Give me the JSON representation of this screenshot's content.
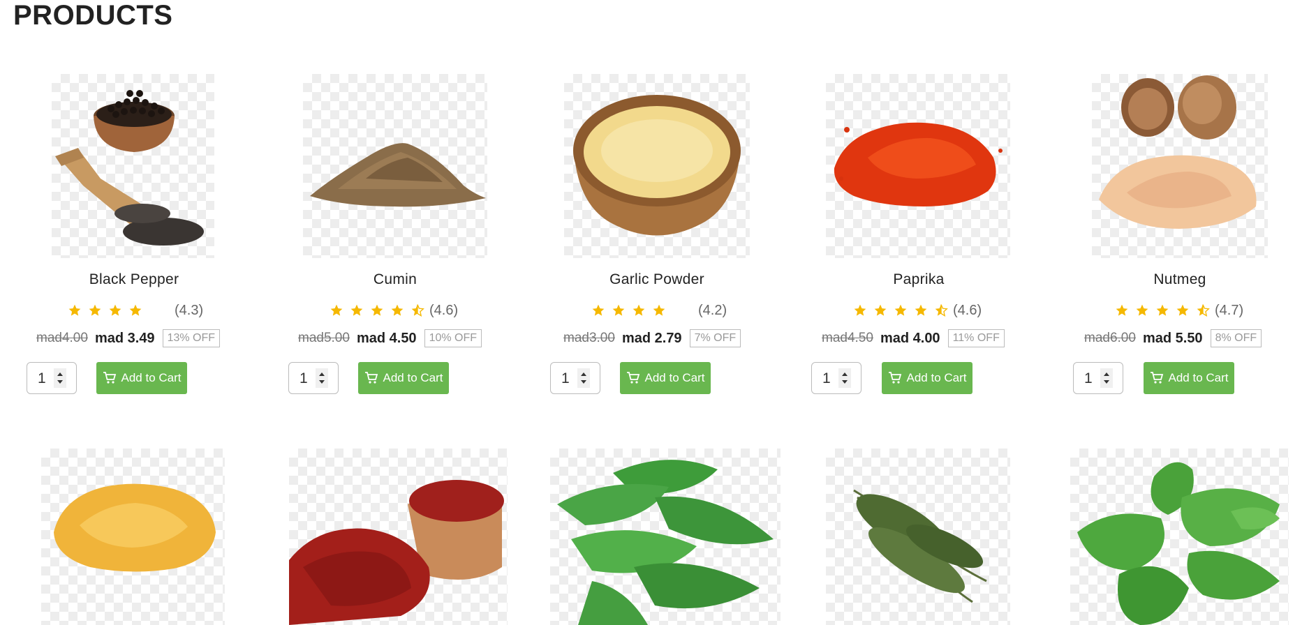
{
  "page": {
    "title": "PRODUCTS"
  },
  "products": [
    {
      "name": "Black Pepper",
      "rating_value": 4.3,
      "rating_text": "(4.3)",
      "old_price": "mad4.00",
      "new_price": "mad 3.49",
      "discount": "13% OFF",
      "quantity": "1",
      "button_label": "Add to Cart"
    },
    {
      "name": "Cumin",
      "rating_value": 4.6,
      "rating_text": "(4.6)",
      "old_price": "mad5.00",
      "new_price": "mad 4.50",
      "discount": "10% OFF",
      "quantity": "1",
      "button_label": "Add to Cart"
    },
    {
      "name": "Garlic Powder",
      "rating_value": 4.2,
      "rating_text": "(4.2)",
      "old_price": "mad3.00",
      "new_price": "mad 2.79",
      "discount": "7% OFF",
      "quantity": "1",
      "button_label": "Add to Cart"
    },
    {
      "name": "Paprika",
      "rating_value": 4.6,
      "rating_text": "(4.6)",
      "old_price": "mad4.50",
      "new_price": "mad 4.00",
      "discount": "11% OFF",
      "quantity": "1",
      "button_label": "Add to Cart"
    },
    {
      "name": "Nutmeg",
      "rating_value": 4.7,
      "rating_text": "(4.7)",
      "old_price": "mad6.00",
      "new_price": "mad 5.50",
      "discount": "8% OFF",
      "quantity": "1",
      "button_label": "Add to Cart"
    }
  ],
  "row2_images": [
    "mustard-seeds-image",
    "saffron-image",
    "bay-leaves-image",
    "thyme-image",
    "basil-image"
  ],
  "colors": {
    "star": "#f5b800",
    "button": "#69b74f",
    "button_text": "#ffffff"
  },
  "icons": {
    "star": "star-icon",
    "half_star": "half-star-icon",
    "cart": "cart-icon",
    "spinner": "spinner-arrows-icon"
  }
}
